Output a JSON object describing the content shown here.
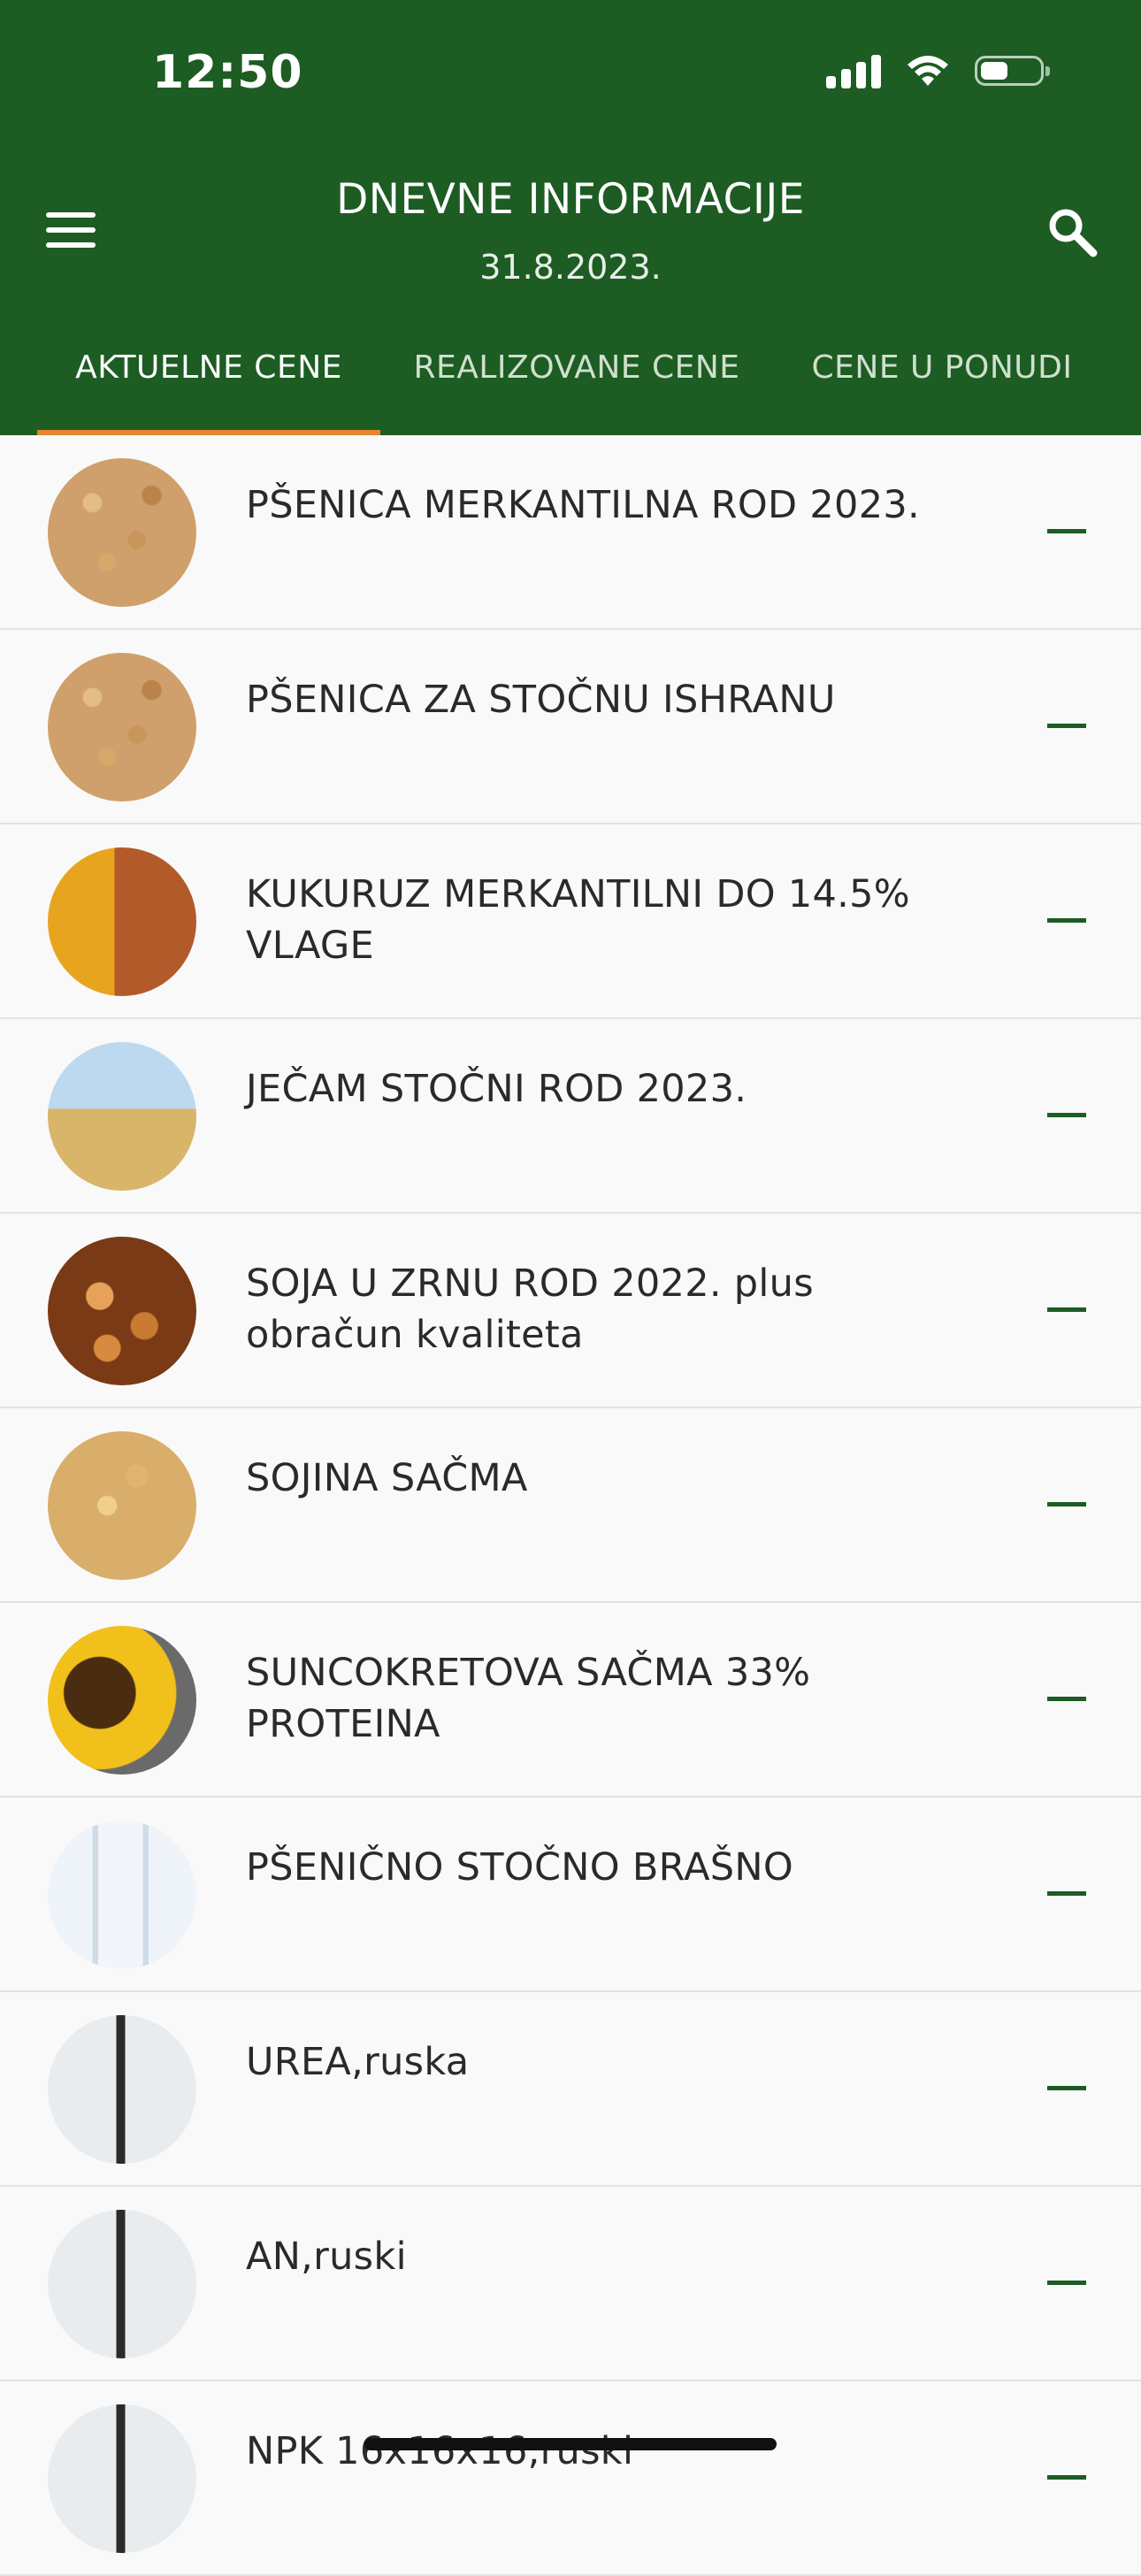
{
  "status_bar": {
    "time": "12:50"
  },
  "header": {
    "title": "DNEVNE INFORMACIJE",
    "date": "31.8.2023.",
    "accent_color": "#1d5c23",
    "indicator_color": "#e3862f"
  },
  "tabs": [
    {
      "label": "AKTUELNE CENE",
      "active": true
    },
    {
      "label": "REALIZOVANE CENE",
      "active": false
    },
    {
      "label": "CENE U PONUDI",
      "active": false
    }
  ],
  "products": [
    {
      "name": "PŠENICA MERKANTILNA ROD 2023.",
      "value": "—"
    },
    {
      "name": "PŠENICA ZA STOČNU ISHRANU",
      "value": "—"
    },
    {
      "name": "KUKURUZ MERKANTILNI DO 14.5% VLAGE",
      "value": "—"
    },
    {
      "name": "JEČAM STOČNI ROD 2023.",
      "value": "—"
    },
    {
      "name": "SOJA U ZRNU ROD 2022. plus obračun kvaliteta",
      "value": "—"
    },
    {
      "name": "SOJINA SAČMA",
      "value": "—"
    },
    {
      "name": "SUNCOKRETOVA SAČMA 33% PROTEINA",
      "value": "—"
    },
    {
      "name": "PŠENIČNO STOČNO BRAŠNO",
      "value": "—"
    },
    {
      "name": "UREA,ruska",
      "value": "—"
    },
    {
      "name": "AN,ruski",
      "value": "—"
    },
    {
      "name": "NPK 16x16x16,ruski",
      "value": "—"
    }
  ]
}
